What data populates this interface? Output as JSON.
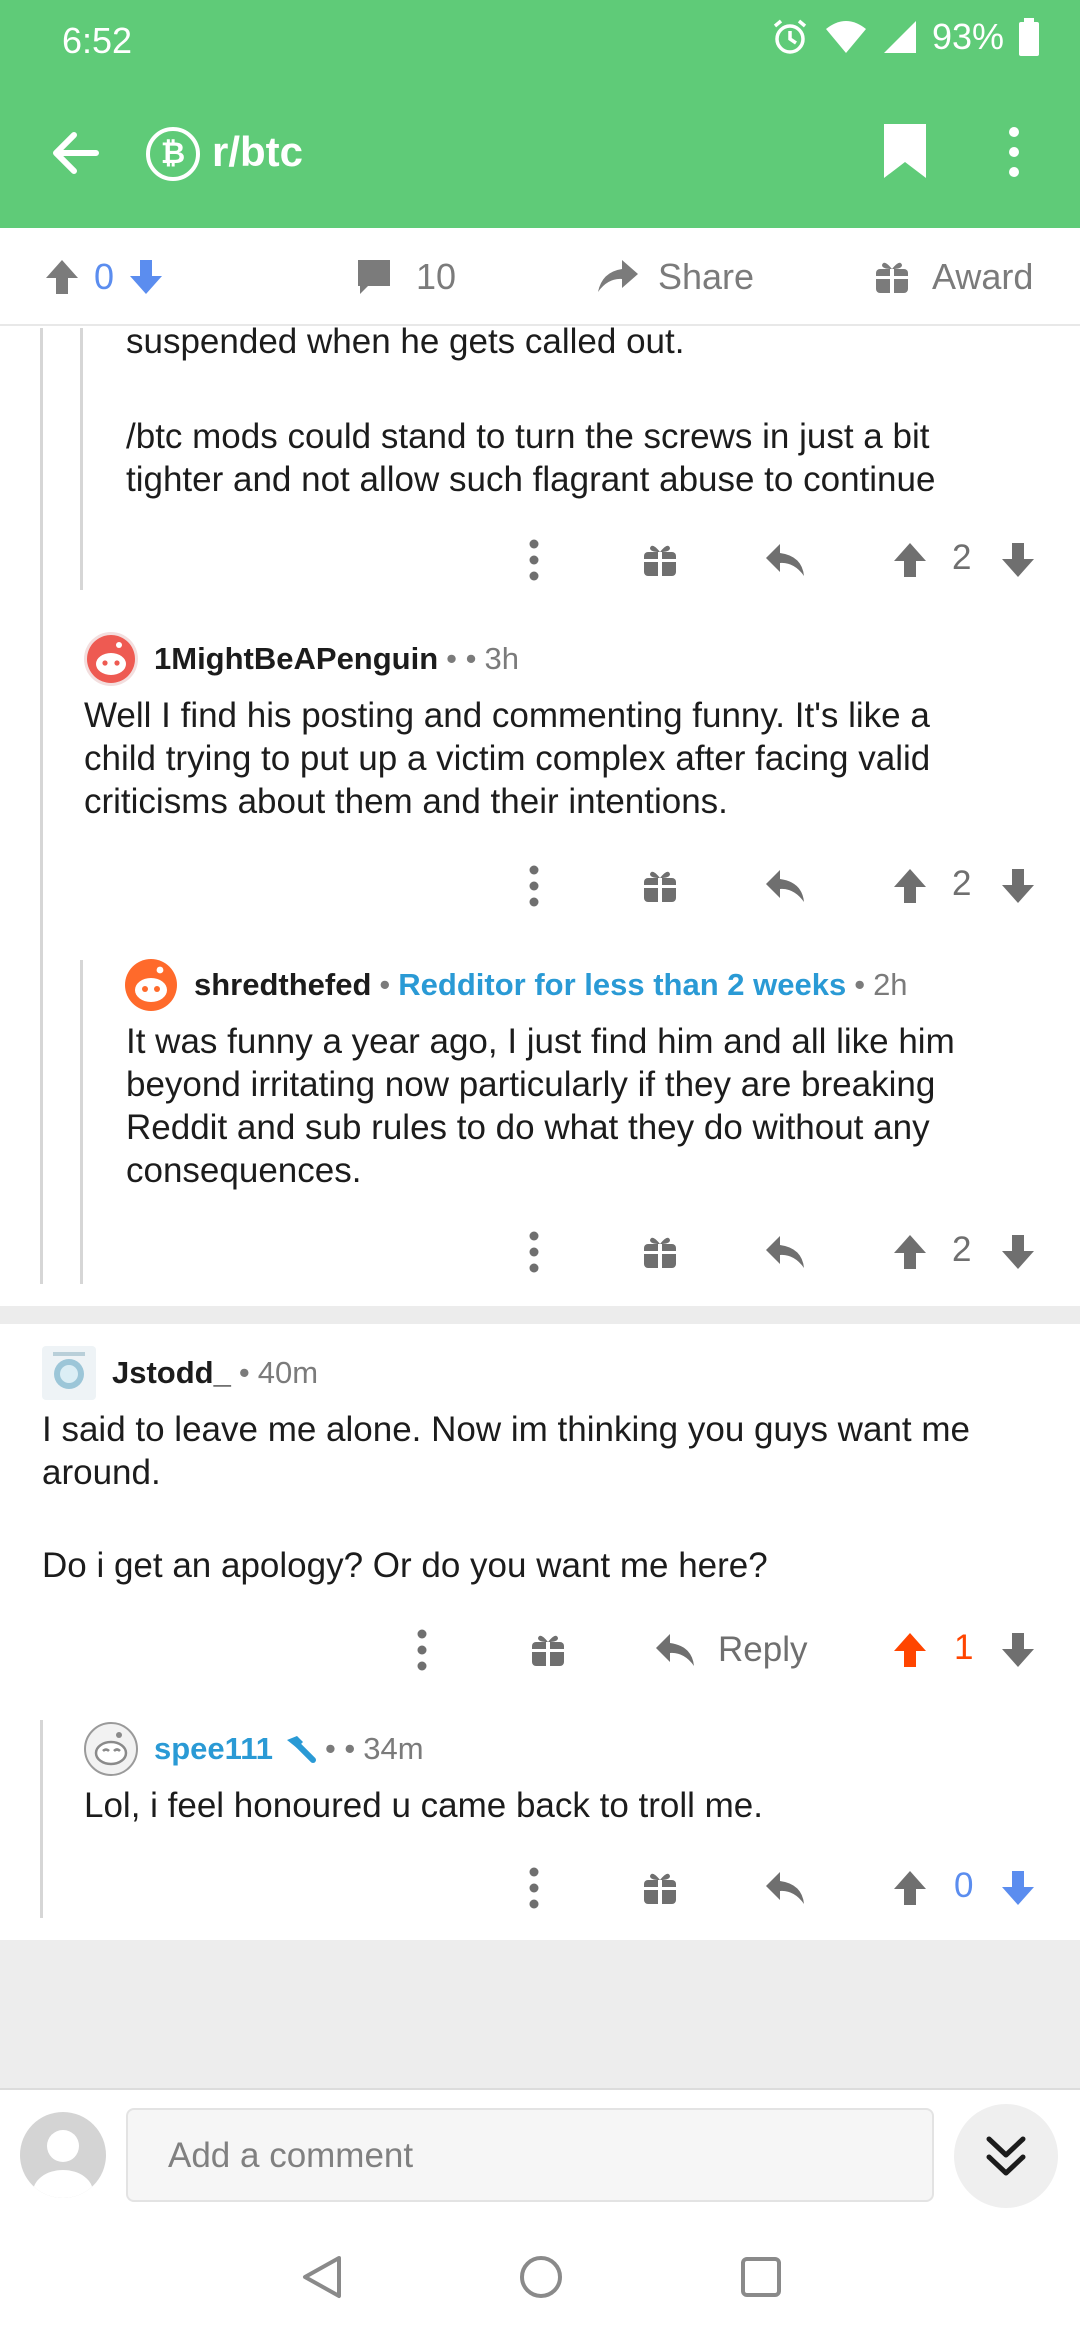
{
  "status_bar": {
    "time": "6:52",
    "battery": "93%"
  },
  "app_bar": {
    "subreddit": "r/btc",
    "sub_icon_glyph": "₿"
  },
  "post_actions": {
    "score": "0",
    "comments": "10",
    "share": "Share",
    "award": "Award"
  },
  "comments": [
    {
      "text_lines": [
        "suspended when he gets called out.",
        "",
        "/btc mods could stand to turn the screws in just a bit",
        "tighter and not allow such flagrant abuse to continue"
      ],
      "score": "2"
    },
    {
      "username": "1MightBeAPenguin",
      "age": "3h",
      "text_lines": [
        "Well I find his posting and commenting funny. It's like a",
        "child trying to put up a victim complex after facing valid",
        "criticisms about them and their intentions."
      ],
      "score": "2"
    },
    {
      "username": "shredthefed",
      "flair": "Redditor for less than 2 weeks",
      "age": "2h",
      "text_lines": [
        "It was funny a year ago, I just find him and all like him",
        "beyond irritating now particularly if they are breaking",
        "Reddit and sub rules to do what they do without any",
        "consequences."
      ],
      "score": "2"
    },
    {
      "username": "Jstodd_",
      "age": "40m",
      "text_lines": [
        "I said to leave me alone. Now im thinking you guys want me",
        "around.",
        "",
        "Do i get an apology? Or do you want me here?"
      ],
      "reply_label": "Reply",
      "score": "1"
    },
    {
      "username": "spee111",
      "age": "34m",
      "text_lines": [
        "Lol, i feel honoured u came back to troll me."
      ],
      "score": "0"
    }
  ],
  "comment_bar": {
    "placeholder": "Add a comment"
  },
  "colors": {
    "header": "#5fcb78",
    "upvoted": "#ff4500",
    "downvoted": "#5b8def",
    "mod_blue": "#2a9ad5"
  }
}
